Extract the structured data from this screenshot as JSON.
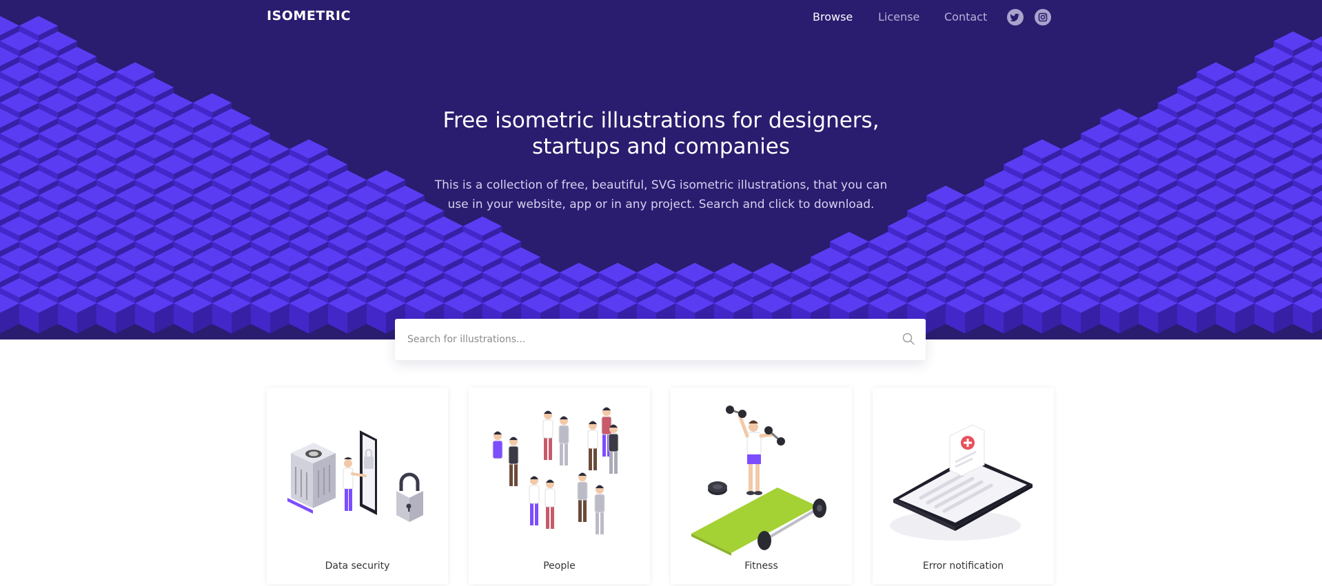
{
  "nav": {
    "logo": "ISOMETRIC",
    "links": [
      {
        "label": "Browse",
        "active": true
      },
      {
        "label": "License",
        "active": false
      },
      {
        "label": "Contact",
        "active": false
      }
    ],
    "social": [
      {
        "icon": "twitter-icon"
      },
      {
        "icon": "instagram-icon"
      }
    ]
  },
  "hero": {
    "title_line1": "Free isometric illustrations for designers,",
    "title_line2": "startups and companies",
    "subtitle_line1": "This is a collection of free, beautiful, SVG isometric illustrations, that you can",
    "subtitle_line2": "use in your website, app or in any project. Search and click to download."
  },
  "search": {
    "placeholder": "Search for illustrations...",
    "value": "",
    "icon": "search-icon"
  },
  "cards": [
    {
      "label": "Data security",
      "icon": "data-security-illustration"
    },
    {
      "label": "People",
      "icon": "people-illustration"
    },
    {
      "label": "Fitness",
      "icon": "fitness-illustration"
    },
    {
      "label": "Error notification",
      "icon": "error-notification-illustration"
    }
  ],
  "colors": {
    "hero_bg": "#2a1c6f",
    "cube_top": "#5a3cf2",
    "cube_left": "#4427c9",
    "cube_right": "#3720a6",
    "accent_purple": "#7c4dff",
    "accent_green": "#a4d134",
    "accent_red": "#e8505b"
  }
}
